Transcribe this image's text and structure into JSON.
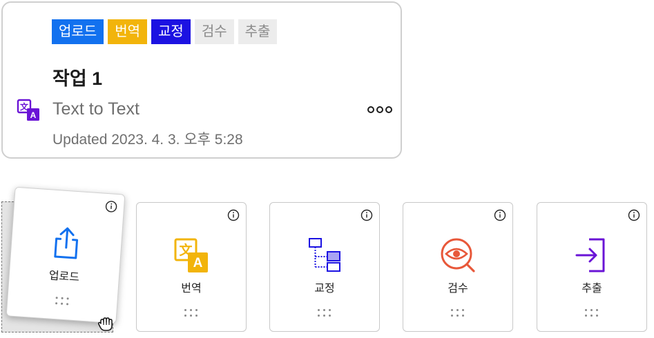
{
  "job": {
    "tags": [
      "업로드",
      "번역",
      "교정",
      "검수",
      "추출"
    ],
    "title": "작업 1",
    "type_icon": "translate-icon",
    "type": "Text to Text",
    "more_icon": "more-horizontal-icon",
    "updated": "Updated 2023. 4. 3. 오후 5:28"
  },
  "steps": [
    {
      "label": "업로드",
      "icon": "upload-icon",
      "color": "#1271ef"
    },
    {
      "label": "번역",
      "icon": "translate-icon",
      "color": "#f2b40b"
    },
    {
      "label": "교정",
      "icon": "hierarchy-icon",
      "color": "#1c12e2"
    },
    {
      "label": "검수",
      "icon": "inspect-icon",
      "color": "#e8583a"
    },
    {
      "label": "추출",
      "icon": "export-icon",
      "color": "#6a14d6"
    }
  ],
  "colors": {
    "upload": "#1271ef",
    "translate": "#f2b40b",
    "proof": "#1c12e2",
    "inactive_tag_bg": "#ececec",
    "inactive_tag_text": "#8a8a8a"
  }
}
